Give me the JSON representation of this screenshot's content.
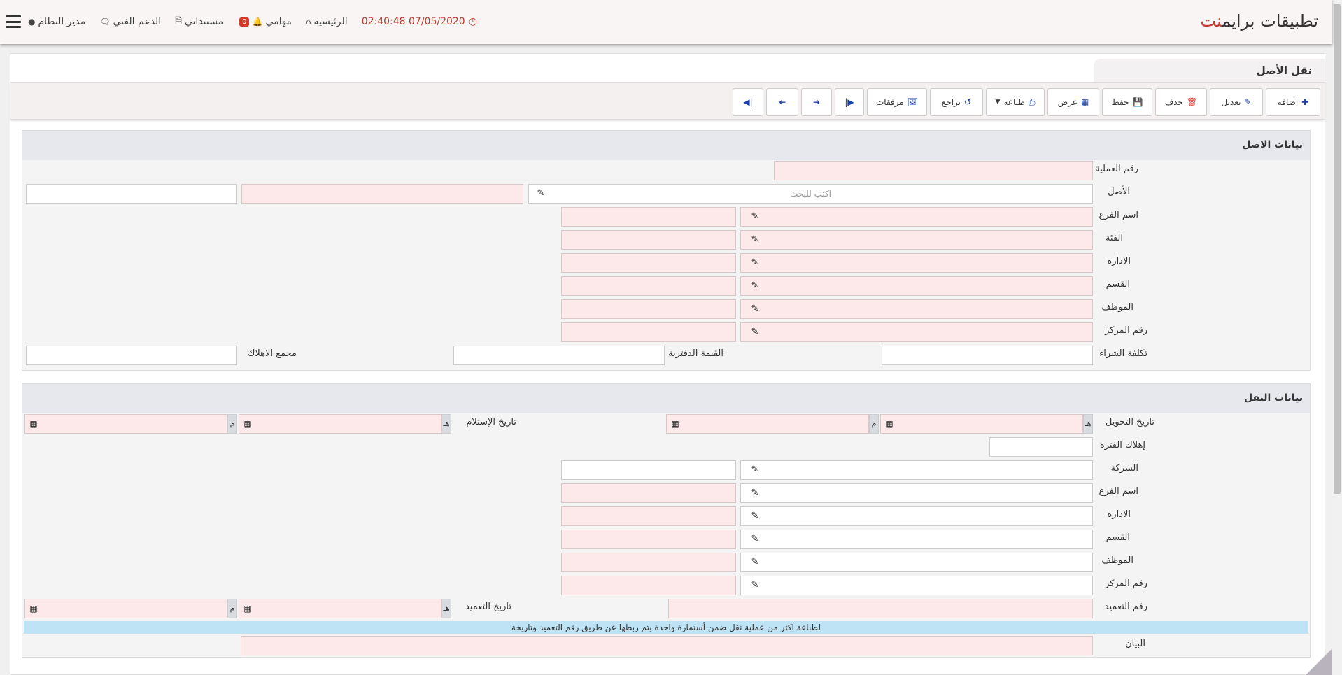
{
  "header": {
    "brand_main": "تطبيقات برايم",
    "brand_accent": "نت",
    "user": "مدير النظام",
    "support": "الدعم الفني",
    "documents": "مستنداتي",
    "tasks": "مهامي",
    "tasks_count": "0",
    "home": "الرئيسية",
    "clock": "02:40:48 07/05/2020",
    "icons": [
      "user-icon",
      "comments-icon",
      "file-icon",
      "bell-icon",
      "home-icon",
      "clock-icon",
      "hamburger-icon"
    ]
  },
  "page": {
    "title": "نقل الأصل"
  },
  "toolbar": {
    "add": "اضافة",
    "edit": "تعديل",
    "delete": "حذف",
    "save": "حفظ",
    "view": "عرض",
    "print": "طباعة",
    "undo": "تراجع",
    "attachments": "مرفقات"
  },
  "asset_section": {
    "title": "بيانات الاصل",
    "operation_no": "رقم العملية",
    "asset": "الأصل",
    "asset_placeholder": "اكتب للبحث",
    "branch": "اسم الفرع",
    "category": "الفئة",
    "department": "الاداره",
    "section": "القسم",
    "employee": "الموظف",
    "cost_center": "رقم المركز",
    "purchase_cost": "تكلفة الشراء",
    "book_value": "القيمة الدفترية",
    "depreciation_total": "مجمع الاهلاك"
  },
  "transfer_section": {
    "title": "بيانات النقل",
    "transfer_date": "تاريخ التحويل",
    "receive_date": "تاريخ الإستلام",
    "hijri_mark": "هـ",
    "greg_mark": "م",
    "period_depreciation": "إهلاك الفترة",
    "company": "الشركة",
    "branch": "اسم الفرع",
    "department": "الاداره",
    "section": "القسم",
    "employee": "الموظف",
    "cost_center": "رقم المركز",
    "assignment_no": "رقم التعميد",
    "assignment_date": "تاريخ التعميد",
    "hint": "لطباعة اكثر من عملية نقل ضمن أستمارة واحدة يتم ربطها عن طريق رقم التعميد وتاريخة",
    "statement": "البيان"
  }
}
